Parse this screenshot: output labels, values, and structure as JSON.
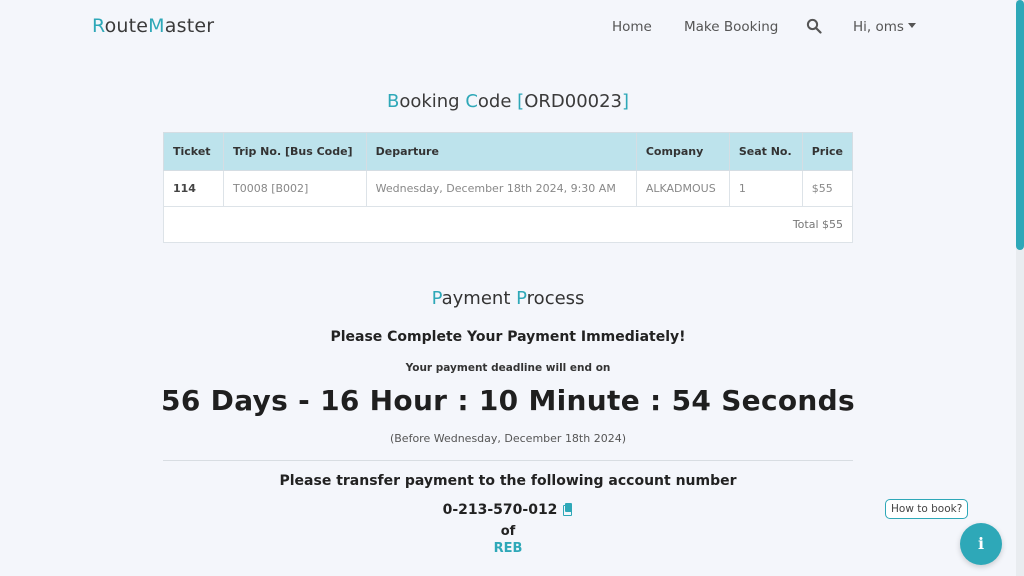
{
  "brand": {
    "first_letter": "R",
    "first_rest": "oute",
    "second_letter": "M",
    "second_rest": "aster"
  },
  "nav": {
    "home": "Home",
    "make_booking": "Make Booking",
    "user_menu": "Hi, oms"
  },
  "booking": {
    "title_b": "B",
    "title_ooking": "ooking",
    "title_c": "C",
    "title_ode": "ode",
    "code": "ORD00023",
    "columns": [
      "Ticket",
      "Trip No. [Bus Code]",
      "Departure",
      "Company",
      "Seat No.",
      "Price"
    ],
    "rows": [
      {
        "ticket": "114",
        "trip": "T0008 [B002]",
        "departure": "Wednesday, December 18th 2024, 9:30 AM",
        "company": "ALKADMOUS",
        "seat": "1",
        "price": "$55"
      }
    ],
    "total": "Total $55"
  },
  "payment": {
    "title_p1": "P",
    "title_ayment": "ayment",
    "title_p2": "P",
    "title_rocess": "rocess",
    "urgent": "Please Complete Your Payment Immediately!",
    "deadline_label": "Your payment deadline will end on",
    "countdown": "56 Days - 16 Hour : 10 Minute : 54 Seconds",
    "before": "(Before Wednesday, December 18th 2024)",
    "transfer": "Please transfer payment to the following account number",
    "account": "0-213-570-012",
    "of": "of",
    "bank": "REB"
  },
  "help": {
    "how_to_book": "How to book?",
    "info_glyph": "i"
  },
  "colors": {
    "accent": "#2ea8b8",
    "table_header": "#bde3ec",
    "background": "#f4f6fb"
  },
  "icons": {
    "search": "search-icon",
    "copy": "copy-icon",
    "info": "info-icon",
    "caret": "chevron-down-icon"
  }
}
